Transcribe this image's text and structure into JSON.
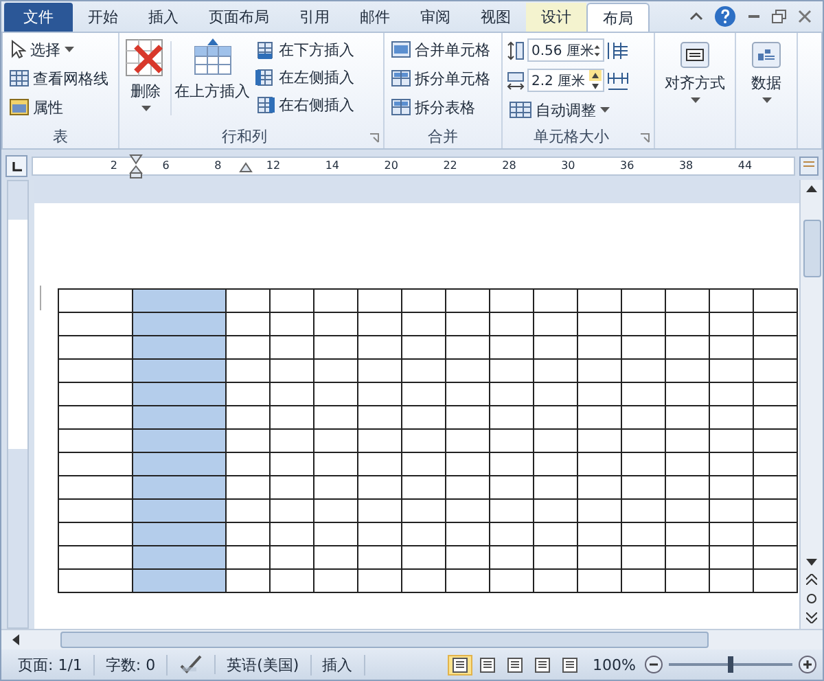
{
  "tabs": [
    {
      "label": "文件",
      "kind": "file",
      "selected": false
    },
    {
      "label": "开始",
      "kind": "normal",
      "selected": false
    },
    {
      "label": "插入",
      "kind": "normal",
      "selected": false
    },
    {
      "label": "页面布局",
      "kind": "normal",
      "selected": false
    },
    {
      "label": "引用",
      "kind": "normal",
      "selected": false
    },
    {
      "label": "邮件",
      "kind": "normal",
      "selected": false
    },
    {
      "label": "审阅",
      "kind": "normal",
      "selected": false
    },
    {
      "label": "视图",
      "kind": "normal",
      "selected": false
    },
    {
      "label": "设计",
      "kind": "contextual",
      "selected": false
    },
    {
      "label": "布局",
      "kind": "contextual",
      "selected": true
    }
  ],
  "ribbon": {
    "table_group": {
      "label": "表",
      "items": [
        "选择",
        "查看网格线",
        "属性"
      ]
    },
    "rows_columns": {
      "label": "行和列",
      "delete": "删除",
      "insert_above": "在上方插入",
      "items": [
        "在下方插入",
        "在左侧插入",
        "在右侧插入"
      ]
    },
    "merge": {
      "label": "合并",
      "items": [
        "合并单元格",
        "拆分单元格",
        "拆分表格"
      ]
    },
    "cell_size": {
      "label": "单元格大小",
      "height": "0.56 厘米",
      "width": "2.2 厘米",
      "autofit": "自动调整"
    },
    "alignment": {
      "label": "对齐方式"
    },
    "data": {
      "label": "数据"
    }
  },
  "ruler": {
    "numbers": [
      "2",
      "6",
      "8",
      "12",
      "14",
      "20",
      "22",
      "28",
      "30",
      "36",
      "38",
      "44"
    ]
  },
  "table": {
    "columns": [
      {
        "selected": false
      },
      {
        "selected": true
      },
      {
        "selected": false
      },
      {
        "selected": false
      },
      {
        "selected": false
      },
      {
        "selected": false
      },
      {
        "selected": false
      },
      {
        "selected": false
      },
      {
        "selected": false
      },
      {
        "selected": false
      },
      {
        "selected": false
      },
      {
        "selected": false
      },
      {
        "selected": false
      },
      {
        "selected": false
      },
      {
        "selected": false
      }
    ]
  },
  "status_bar": {
    "page": "页面: 1/1",
    "words": "字数: 0",
    "language": "英语(美国)",
    "mode": "插入",
    "views": [
      {
        "selected": true
      },
      {
        "selected": false
      },
      {
        "selected": false
      },
      {
        "selected": false
      },
      {
        "selected": false
      }
    ],
    "zoom": "100%",
    "zoom_level": {
      "level": 0.5
    }
  }
}
